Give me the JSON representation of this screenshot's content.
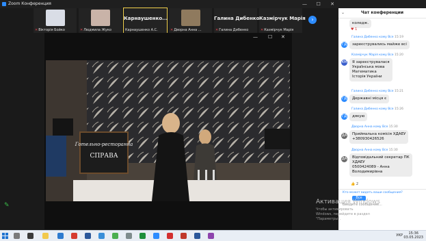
{
  "window": {
    "title": "Zoom Конференция",
    "minimize": "—",
    "maximize": "☐",
    "close": "✕"
  },
  "participants": [
    {
      "name": "Вікторія Бойко",
      "muted": true,
      "thumb_color": "#d9dde6"
    },
    {
      "name": "Людмила Жуко",
      "muted": true,
      "thumb_color": "#c9b3a8"
    },
    {
      "name": "Карнаушенко А.С.",
      "muted": false,
      "big": "Карнаушенко...",
      "active": true
    },
    {
      "name": "Дворна Анна ...",
      "muted": true,
      "thumb_color": "#8f7a5e"
    },
    {
      "name": "Галина Дибенко",
      "muted": true,
      "big": "Галина Дибенко"
    },
    {
      "name": "Казмірчук Марія",
      "muted": true,
      "big": "Казмірчук Марія"
    }
  ],
  "video_window": {
    "minimize": "—",
    "maximize": "☐",
    "close": "✕"
  },
  "chalkboard": {
    "line1": "Готельно-ресторанна",
    "line2": "СПРАВА"
  },
  "chat": {
    "title": "Чат конференции",
    "messages": [
      {
        "sender": "",
        "text": "коледж.",
        "time": "",
        "avatar": "",
        "avatar_color": "#2d8cff",
        "reaction": "♥ 1"
      },
      {
        "sender": "Галина Дибенко кому Все",
        "time": "15:19",
        "avatar": "ГД",
        "avatar_color": "#2d8cff",
        "text": "зареєструвались майже всі"
      },
      {
        "sender": "Казмірчук Марія кому Все",
        "time": "15:20",
        "avatar": "КМ",
        "avatar_color": "#3a5fcd",
        "text": "Я зареєструвалася\nУкраїнська мова\nМатематика\nІсторія України"
      },
      {
        "sender": "Галина Дибенко кому Все",
        "time": "15:21",
        "avatar": "ГД",
        "avatar_color": "#2d8cff",
        "text": "Державні місця є"
      },
      {
        "sender": "Галина Дибенко кому Все",
        "time": "15:26",
        "avatar": "ГД",
        "avatar_color": "#2d8cff",
        "text": "дякую"
      },
      {
        "sender": "Дворна Анна кому Все",
        "time": "15:30",
        "avatar": "ДА",
        "avatar_color": "#6b6b6b",
        "text": "Приймальна комісія ХДАЕУ\n+380930426526"
      },
      {
        "sender": "Дворна Анна кому Все",
        "time": "15:30",
        "avatar": "ДА",
        "avatar_color": "#6b6b6b",
        "text": "Відповідальний секретар ПК\nХДАЕУ\n0500424089 - Анна\nВолодимирівна",
        "reaction": "👍 2"
      }
    ],
    "who_can_see": "Кто может видеть ваши сообщения?",
    "send_to": "Все",
    "placeholder": "Введите сообщение..."
  },
  "activation": {
    "title": "Активация Windows",
    "subtitle": "Чтобы активировать Windows, перейдите в раздел \"Параметры\"."
  },
  "taskbar": {
    "lang": "УКР",
    "time": "15:36",
    "date": "03.05.2023"
  }
}
